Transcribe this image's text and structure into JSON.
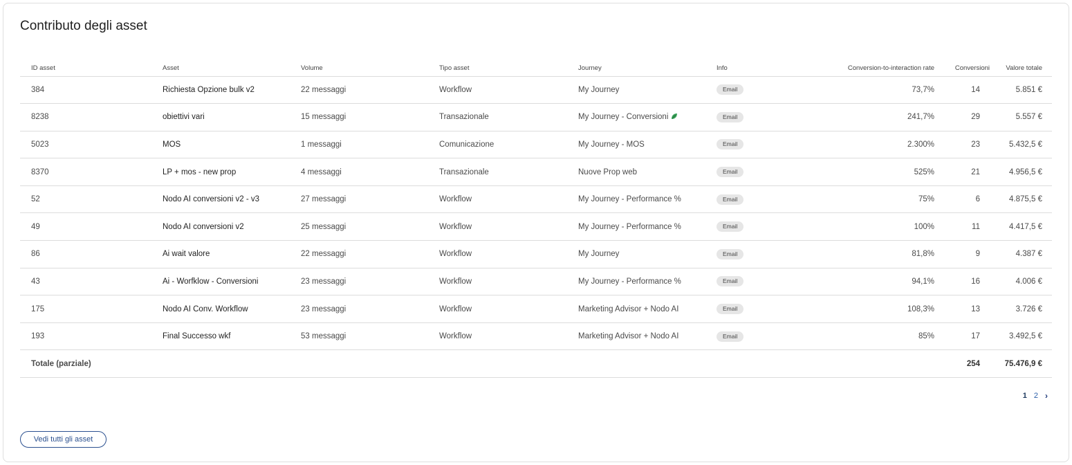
{
  "card": {
    "title": "Contributo degli asset"
  },
  "table": {
    "headers": {
      "id": "ID asset",
      "asset": "Asset",
      "volume": "Volume",
      "type": "Tipo asset",
      "journey": "Journey",
      "info": "Info",
      "rate": "Conversion-to-interaction rate",
      "conversions": "Conversioni",
      "value": "Valore totale"
    },
    "rows": [
      {
        "id": "384",
        "asset": "Richiesta Opzione bulk v2",
        "volume": "22 messaggi",
        "type": "Workflow",
        "journey": "My Journey",
        "info": "Email",
        "rate": "73,7%",
        "conversions": "14",
        "value": "5.851 €"
      },
      {
        "id": "8238",
        "asset": "obiettivi vari",
        "volume": "15 messaggi",
        "type": "Transazionale",
        "journey": "My Journey - Conversioni",
        "info": "Email",
        "rate": "241,7%",
        "conversions": "29",
        "value": "5.557 €",
        "journey_icon": "leaf-icon"
      },
      {
        "id": "5023",
        "asset": "MOS",
        "volume": "1 messaggi",
        "type": "Comunicazione",
        "journey": "My Journey - MOS",
        "info": "Email",
        "rate": "2.300%",
        "conversions": "23",
        "value": "5.432,5 €"
      },
      {
        "id": "8370",
        "asset": "LP + mos - new prop",
        "volume": "4 messaggi",
        "type": "Transazionale",
        "journey": "Nuove Prop web",
        "info": "Email",
        "rate": "525%",
        "conversions": "21",
        "value": "4.956,5 €"
      },
      {
        "id": "52",
        "asset": "Nodo AI conversioni v2 - v3",
        "volume": "27 messaggi",
        "type": "Workflow",
        "journey": "My Journey - Performance %",
        "info": "Email",
        "rate": "75%",
        "conversions": "6",
        "value": "4.875,5 €"
      },
      {
        "id": "49",
        "asset": "Nodo AI conversioni v2",
        "volume": "25 messaggi",
        "type": "Workflow",
        "journey": "My Journey - Performance %",
        "info": "Email",
        "rate": "100%",
        "conversions": "11",
        "value": "4.417,5 €"
      },
      {
        "id": "86",
        "asset": "Ai wait valore",
        "volume": "22 messaggi",
        "type": "Workflow",
        "journey": "My Journey",
        "info": "Email",
        "rate": "81,8%",
        "conversions": "9",
        "value": "4.387 €"
      },
      {
        "id": "43",
        "asset": "Ai - Worfklow - Conversioni",
        "volume": "23 messaggi",
        "type": "Workflow",
        "journey": "My Journey - Performance %",
        "info": "Email",
        "rate": "94,1%",
        "conversions": "16",
        "value": "4.006 €"
      },
      {
        "id": "175",
        "asset": "Nodo AI Conv. Workflow",
        "volume": "23 messaggi",
        "type": "Workflow",
        "journey": "Marketing Advisor + Nodo AI",
        "info": "Email",
        "rate": "108,3%",
        "conversions": "13",
        "value": "3.726 €"
      },
      {
        "id": "193",
        "asset": "Final Successo wkf",
        "volume": "53 messaggi",
        "type": "Workflow",
        "journey": "Marketing Advisor + Nodo AI",
        "info": "Email",
        "rate": "85%",
        "conversions": "17",
        "value": "3.492,5 €"
      }
    ],
    "total": {
      "label": "Totale (parziale)",
      "conversions": "254",
      "value": "75.476,9 €"
    }
  },
  "pagination": {
    "pages": [
      "1",
      "2"
    ],
    "current": "1",
    "next_icon": "chevron-right-icon"
  },
  "actions": {
    "view_all_label": "Vedi tutti gli asset"
  },
  "colors": {
    "accent": "#2a4f8f",
    "badge_bg": "#e6e6e6",
    "border": "#dcdcdc"
  }
}
